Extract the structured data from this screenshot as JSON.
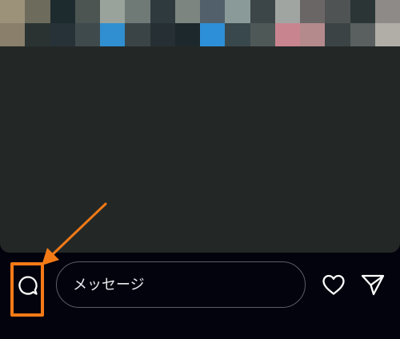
{
  "message_input": {
    "placeholder": "メッセージ",
    "value": ""
  },
  "icons": {
    "comment": "comment-bubble-icon",
    "like": "heart-icon",
    "send": "paper-plane-icon"
  },
  "colors": {
    "background": "#03030d",
    "media_background": "#232827",
    "highlight": "#f47a16",
    "icon": "#ffffff",
    "input_border": "#5b5d66"
  }
}
